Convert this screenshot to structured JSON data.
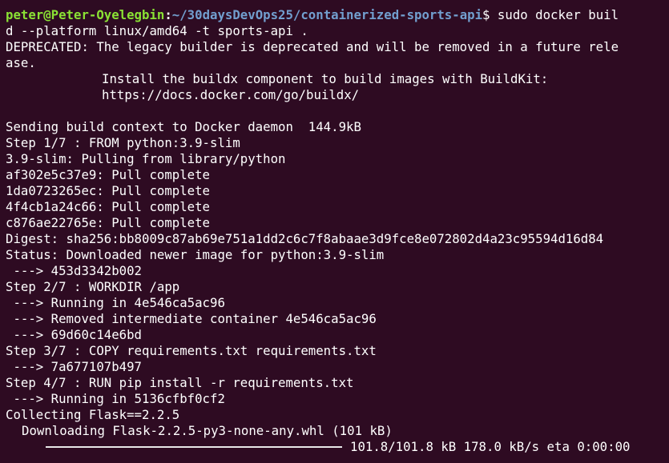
{
  "prompt": {
    "user_host": "peter@Peter-Oyelegbin",
    "colon": ":",
    "path": "~/30daysDevOps25/containerized-sports-api",
    "dollar": "$",
    "command_line1": " sudo docker buil",
    "command_line2": "d --platform linux/amd64 -t sports-api ."
  },
  "deprecation": {
    "line1": "DEPRECATED: The legacy builder is deprecated and will be removed in a future rele",
    "line2": "ase.",
    "line3": "Install the buildx component to build images with BuildKit:",
    "line4": "https://docs.docker.com/go/buildx/"
  },
  "output": [
    "Sending build context to Docker daemon  144.9kB",
    "Step 1/7 : FROM python:3.9-slim",
    "3.9-slim: Pulling from library/python",
    "af302e5c37e9: Pull complete",
    "1da0723265ec: Pull complete",
    "4f4cb1a24c66: Pull complete",
    "c876ae22765e: Pull complete",
    "Digest: sha256:bb8009c87ab69e751a1dd2c6c7f8abaae3d9fce8e072802d4a23c95594d16d84",
    "Status: Downloaded newer image for python:3.9-slim",
    " ---> 453d3342b002",
    "Step 2/7 : WORKDIR /app",
    " ---> Running in 4e546ca5ac96",
    " ---> Removed intermediate container 4e546ca5ac96",
    " ---> 69d60c14e6bd",
    "Step 3/7 : COPY requirements.txt requirements.txt",
    " ---> 7a677107b497",
    "Step 4/7 : RUN pip install -r requirements.txt",
    " ---> Running in 5136cfbf0cf2",
    "Collecting Flask==2.2.5",
    "Downloading Flask-2.2.5-py3-none-any.whl (101 kB)"
  ],
  "progress": {
    "fraction": 1.0,
    "text": "101.8/101.8 kB 178.0 kB/s eta 0:00:00"
  },
  "colors": {
    "background": "#2e0b22",
    "prompt_user": "#8ae234",
    "prompt_path": "#729fcf",
    "text": "#ffffff"
  }
}
